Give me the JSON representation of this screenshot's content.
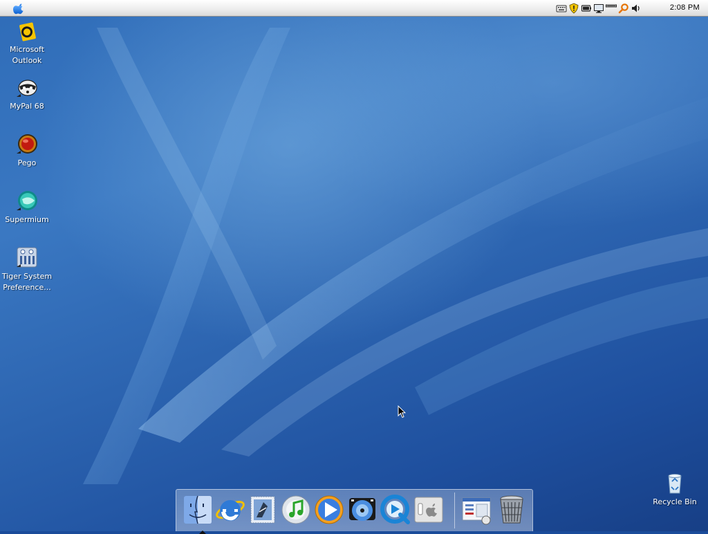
{
  "menubar": {
    "clock": "2:08 PM",
    "tray": [
      "keyboard-icon",
      "shield-icon",
      "battery-icon",
      "display-icon",
      "network-icon",
      "search-icon",
      "volume-icon"
    ]
  },
  "desktop": {
    "icons": [
      {
        "label": "Microsoft Outlook",
        "icon": "outlook-icon"
      },
      {
        "label": "MyPal 68",
        "icon": "raccoon-icon"
      },
      {
        "label": "Pego",
        "icon": "pego-icon"
      },
      {
        "label": "Supermium",
        "icon": "supermium-icon"
      },
      {
        "label": "Tiger System Preference...",
        "icon": "system-preferences-icon"
      }
    ],
    "recycle_bin": {
      "label": "Recycle Bin",
      "icon": "recycle-bin-icon"
    }
  },
  "dock": {
    "items": [
      {
        "name": "Finder",
        "icon": "finder-icon",
        "running": true
      },
      {
        "name": "Internet Explorer",
        "icon": "internet-explorer-icon"
      },
      {
        "name": "Mail",
        "icon": "mail-stamp-icon"
      },
      {
        "name": "iTunes",
        "icon": "itunes-icon"
      },
      {
        "name": "Media Player",
        "icon": "media-player-icon"
      },
      {
        "name": "DVD Player",
        "icon": "dvd-player-icon"
      },
      {
        "name": "QuickTime",
        "icon": "quicktime-icon"
      },
      {
        "name": "Boot Camp",
        "icon": "boot-camp-icon"
      },
      {
        "name": "Control Panel",
        "icon": "control-panel-icon"
      },
      {
        "name": "Trash",
        "icon": "trash-icon"
      }
    ]
  },
  "colors": {
    "wallpaper_light": "#3a78c2",
    "wallpaper_dark": "#173f86",
    "menubar": "#ececec"
  }
}
